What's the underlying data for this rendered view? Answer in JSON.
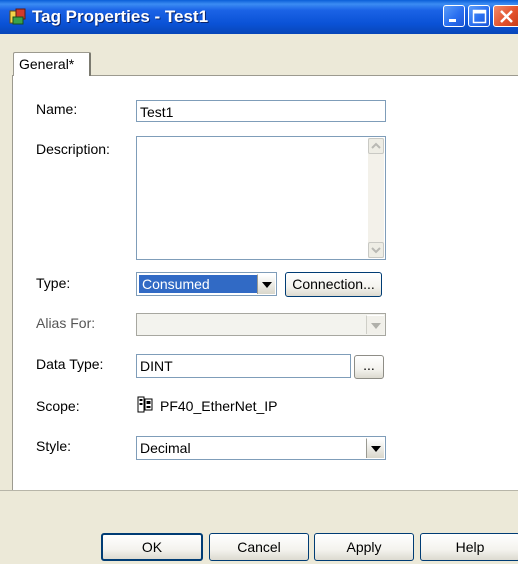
{
  "window": {
    "title": "Tag Properties - Test1"
  },
  "tabs": [
    {
      "label": "General*"
    }
  ],
  "form": {
    "name": {
      "label": "Name:",
      "value": "Test1"
    },
    "description": {
      "label": "Description:",
      "value": ""
    },
    "type": {
      "label": "Type:",
      "value": "Consumed",
      "connection_button": "Connection..."
    },
    "alias_for": {
      "label": "Alias For:",
      "value": ""
    },
    "data_type": {
      "label": "Data Type:",
      "value": "DINT",
      "browse_button": "..."
    },
    "scope": {
      "label": "Scope:",
      "value": "PF40_EtherNet_IP"
    },
    "style": {
      "label": "Style:",
      "value": "Decimal"
    }
  },
  "buttons": {
    "ok": "OK",
    "cancel": "Cancel",
    "apply": "Apply",
    "help": "Help"
  },
  "icons": {
    "title": "tag-properties-app-icon",
    "scope": "controller-scope-icon"
  },
  "colors": {
    "title_bar": "#0a52d6",
    "selection": "#316ac5",
    "dialog_bg": "#ece9d8"
  }
}
